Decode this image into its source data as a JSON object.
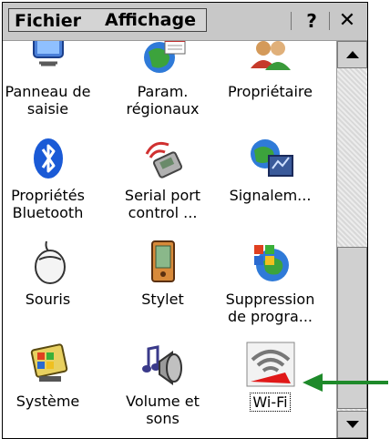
{
  "menubar": {
    "fichier_label": "Fichier",
    "affichage_label": "Affichage",
    "help_label": "?",
    "close_label": "✕"
  },
  "items": [
    {
      "line1": "Panneau de",
      "line2": "saisie",
      "icon": "keyboard-monitor-icon"
    },
    {
      "line1": "Param.",
      "line2": "régionaux",
      "icon": "globe-calendar-icon"
    },
    {
      "line1": "Propriétaire",
      "line2": "",
      "icon": "users-icon"
    },
    {
      "line1": "Propriétés",
      "line2": "Bluetooth",
      "icon": "bluetooth-icon"
    },
    {
      "line1": "Serial port",
      "line2": "control ...",
      "icon": "serial-port-icon"
    },
    {
      "line1": "Signalem...",
      "line2": "",
      "icon": "globe-signal-icon"
    },
    {
      "line1": "Souris",
      "line2": "",
      "icon": "mouse-icon"
    },
    {
      "line1": "Stylet",
      "line2": "",
      "icon": "pda-stylus-icon"
    },
    {
      "line1": "Suppression",
      "line2": "de progra...",
      "icon": "windows-remove-icon"
    },
    {
      "line1": "Système",
      "line2": "",
      "icon": "system-monitor-icon"
    },
    {
      "line1": "Volume et",
      "line2": "sons",
      "icon": "speaker-note-icon"
    },
    {
      "line1": "Wi-Fi",
      "line2": "",
      "icon": "wifi-icon"
    }
  ],
  "selected_item": "Wi-Fi",
  "colors": {
    "menubar_bg": "#c8c8c8",
    "arrow": "#1e8a2a",
    "wifi_red": "#e01818"
  }
}
